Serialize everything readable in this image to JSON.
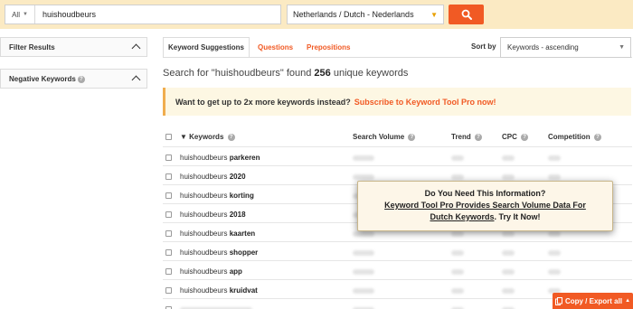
{
  "search": {
    "scope": "All",
    "query": "huishoudbeurs",
    "language": "Netherlands / Dutch - Nederlands"
  },
  "sidebar": {
    "filter_results": "Filter Results",
    "negative_keywords": "Negative Keywords"
  },
  "tabs": [
    {
      "label": "Keyword Suggestions"
    },
    {
      "label": "Questions"
    },
    {
      "label": "Prepositions"
    }
  ],
  "sort": {
    "label": "Sort by",
    "value": "Keywords - ascending"
  },
  "summary": {
    "prefix": "Search for \"huishoudbeurs\" found ",
    "count": "256",
    "suffix": " unique keywords"
  },
  "promo": {
    "text": "Want to get up to 2x more keywords instead?",
    "link": "Subscribe to Keyword Tool Pro now!"
  },
  "table": {
    "columns": [
      "Keywords",
      "Search Volume",
      "Trend",
      "CPC",
      "Competition"
    ],
    "rows": [
      {
        "base": "huishoudbeurs",
        "suffix": "parkeren"
      },
      {
        "base": "huishoudbeurs",
        "suffix": "2020"
      },
      {
        "base": "huishoudbeurs",
        "suffix": "korting"
      },
      {
        "base": "huishoudbeurs",
        "suffix": "2018"
      },
      {
        "base": "huishoudbeurs",
        "suffix": "kaarten"
      },
      {
        "base": "huishoudbeurs",
        "suffix": "shopper"
      },
      {
        "base": "huishoudbeurs",
        "suffix": "app"
      },
      {
        "base": "huishoudbeurs",
        "suffix": "kruidvat"
      }
    ]
  },
  "overlay": {
    "line1": "Do You Need This Information?",
    "line2": "Keyword Tool Pro Provides Search Volume Data For",
    "line3_link": "Dutch Keywords",
    "line3_rest": ". Try It Now!"
  },
  "export": {
    "label": "Copy / Export all"
  },
  "colors": {
    "accent": "#f15a24",
    "topbar": "#fbeac3",
    "promo_border": "#f0ad4e"
  }
}
